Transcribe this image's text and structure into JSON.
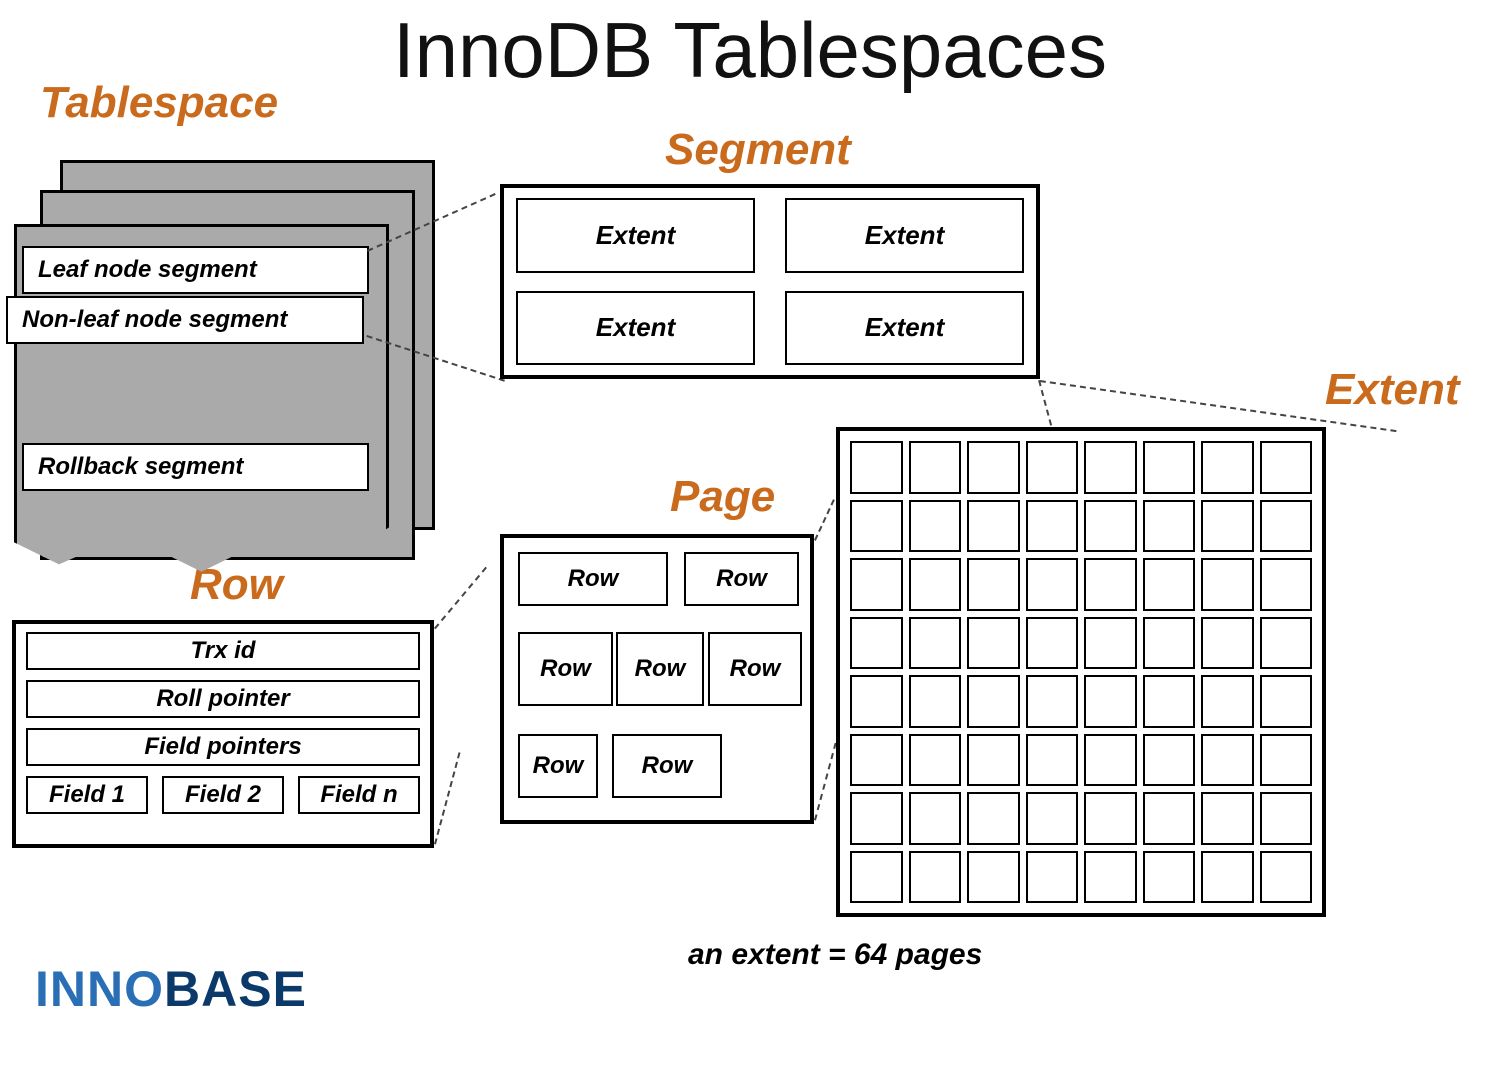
{
  "title": "InnoDB Tablespaces",
  "labels": {
    "tablespace": "Tablespace",
    "segment": "Segment",
    "extent": "Extent",
    "page": "Page",
    "row": "Row"
  },
  "tablespace": {
    "leaf": "Leaf node segment",
    "nonleaf": "Non-leaf node segment",
    "rollback": "Rollback segment"
  },
  "segment": {
    "extent1": "Extent",
    "extent2": "Extent",
    "extent3": "Extent",
    "extent4": "Extent"
  },
  "extent": {
    "grid_size": 8,
    "page_count": 64
  },
  "page": {
    "rows": [
      "Row",
      "Row",
      "Row",
      "Row",
      "Row",
      "Row",
      "Row"
    ]
  },
  "row": {
    "trx": "Trx id",
    "roll": "Roll pointer",
    "fieldptr": "Field pointers",
    "f1": "Field 1",
    "f2": "Field 2",
    "fn": "Field n"
  },
  "footnote": "an extent = 64 pages",
  "logo": {
    "part1": "INNO",
    "part2": "BASE"
  },
  "colors": {
    "accent": "#c96a1c",
    "logo1": "#2a6fb5",
    "logo2": "#0b3a6a"
  }
}
